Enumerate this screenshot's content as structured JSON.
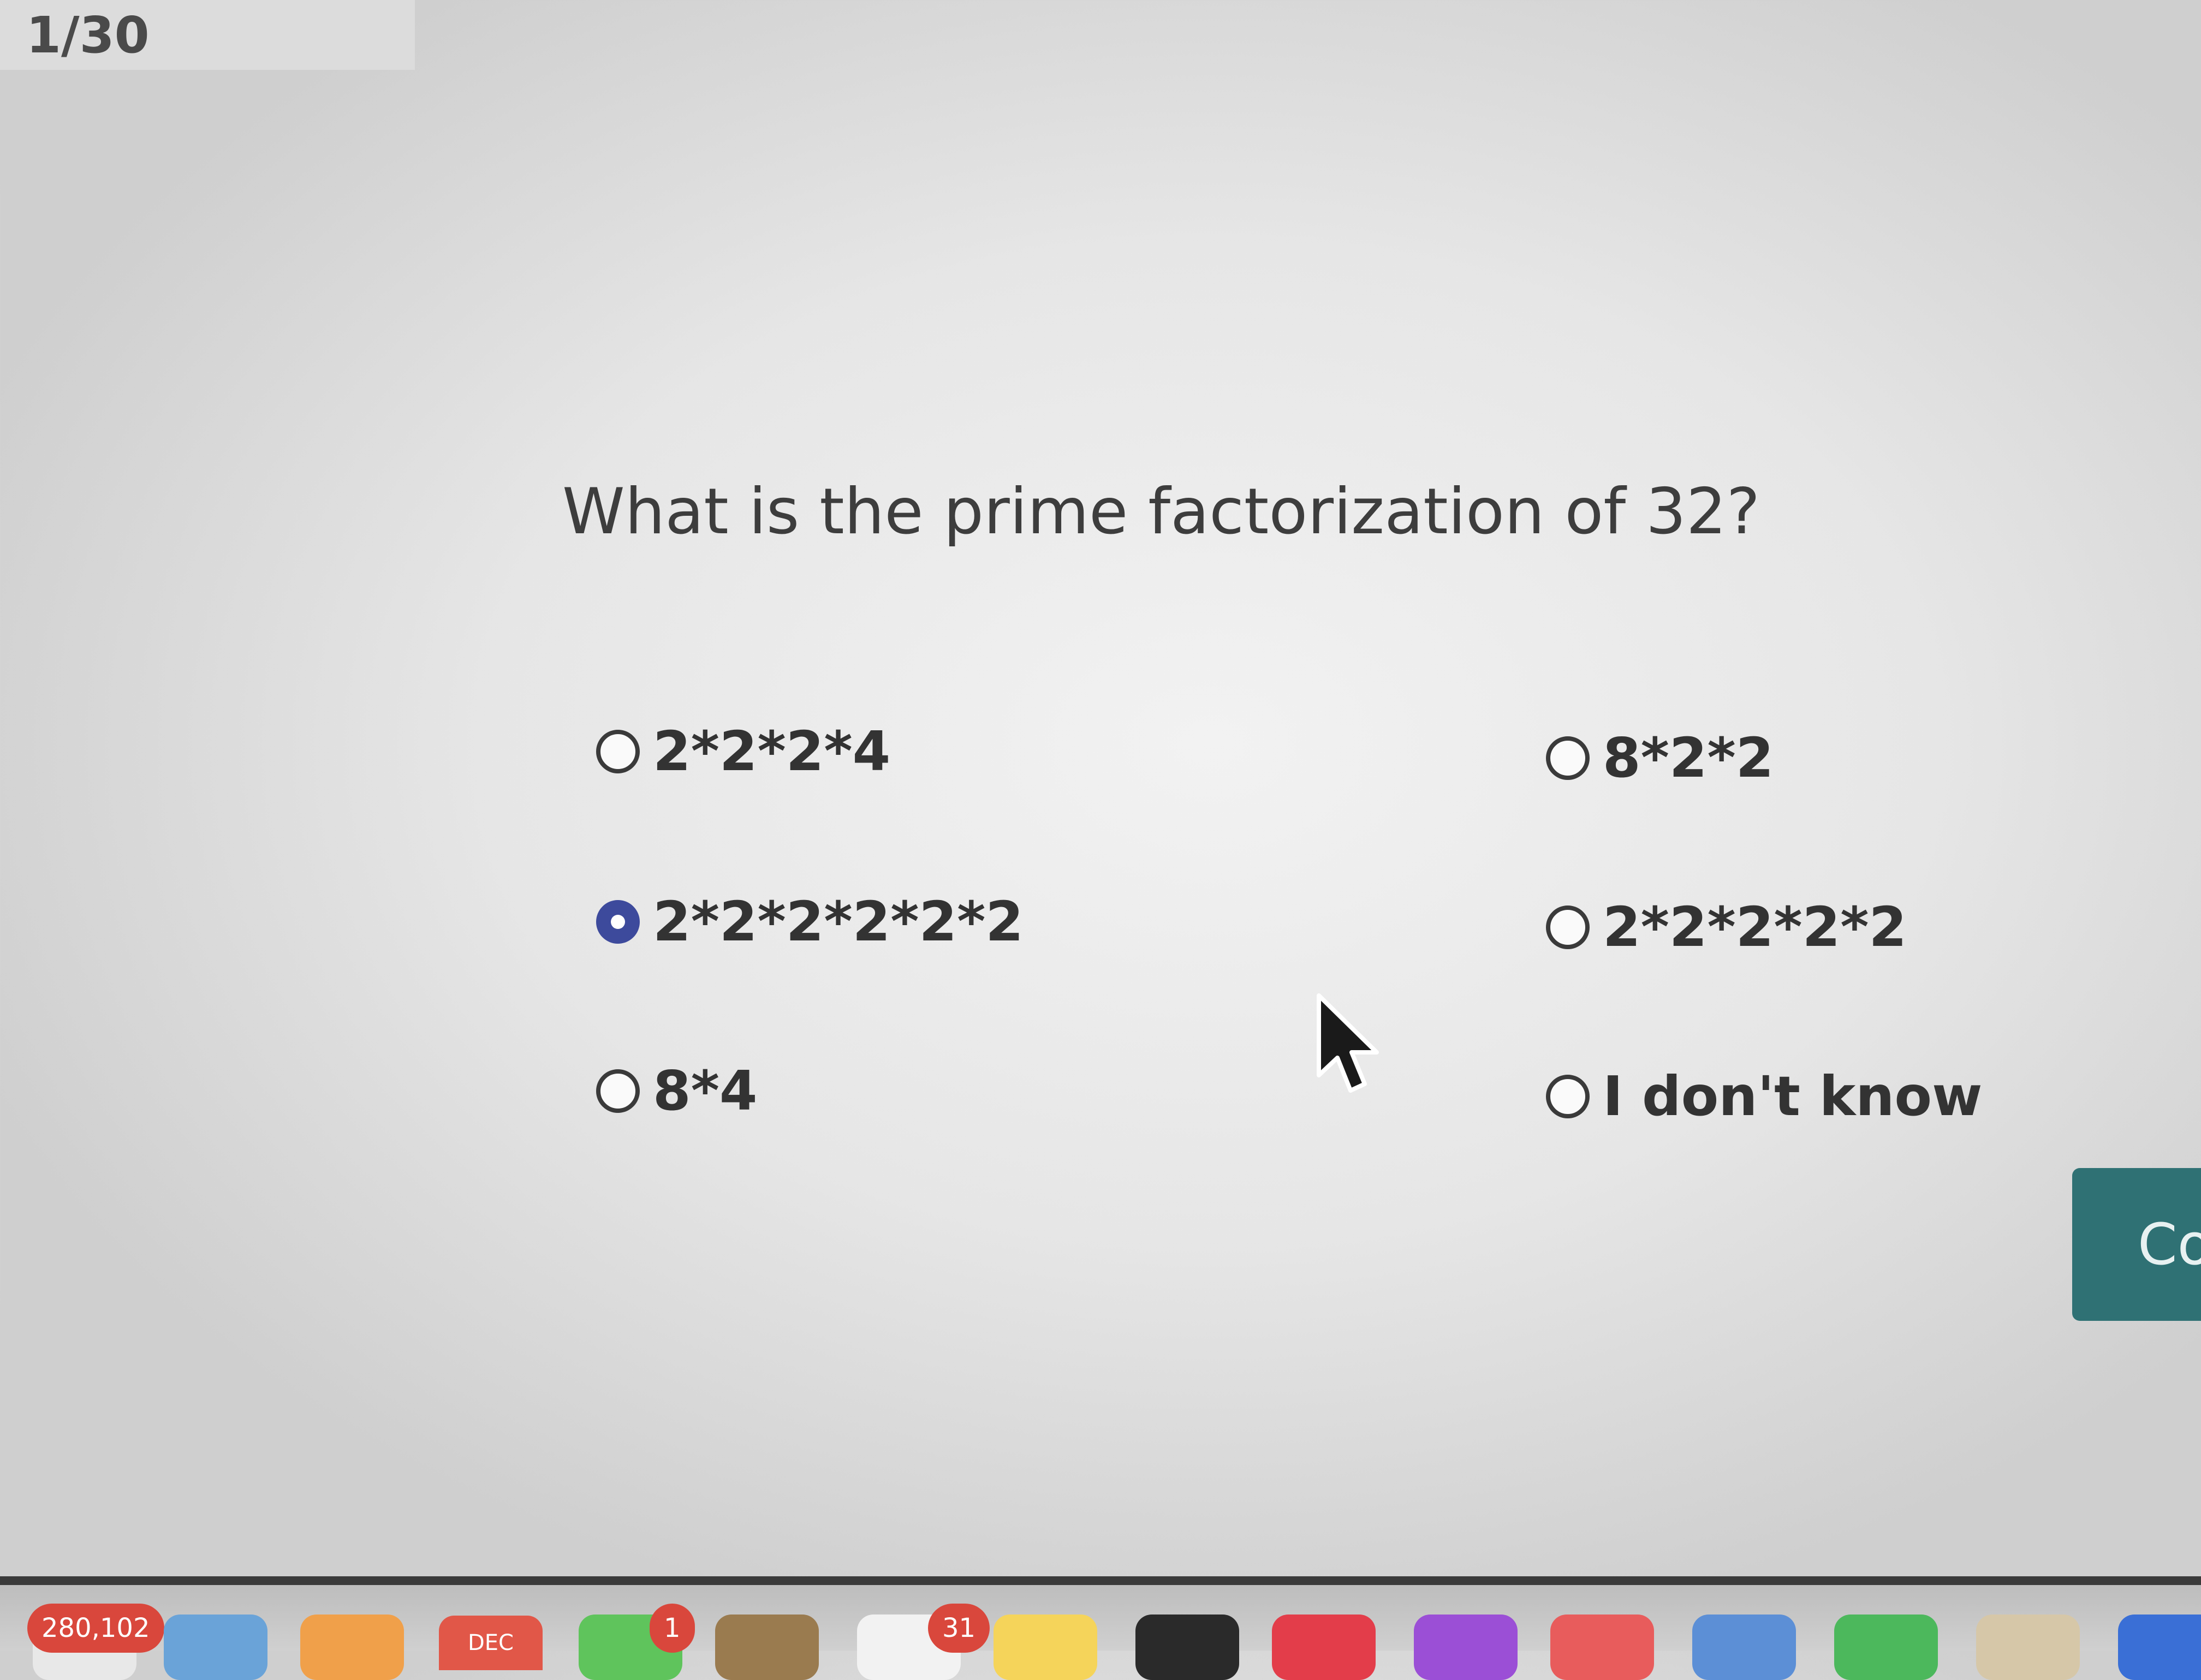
{
  "progress": {
    "label": "1/30"
  },
  "question": {
    "text": "What is the prime factorization of 32?"
  },
  "options": [
    {
      "label": "2*2*2*4",
      "selected": false
    },
    {
      "label": "2*2*2*2*2*2",
      "selected": true
    },
    {
      "label": "8*4",
      "selected": false
    },
    {
      "label": "8*2*2",
      "selected": false
    },
    {
      "label": "2*2*2*2*2",
      "selected": false
    },
    {
      "label": "I don't know",
      "selected": false
    }
  ],
  "continue_button": {
    "label": "Co"
  },
  "dock": {
    "badge_mail_count": "280,102",
    "calendar_month": "DEC",
    "badge_messages_count": "1",
    "badge_calendar_day": "31"
  },
  "colors": {
    "selected_radio": "#3d4a9c",
    "continue_button": "#2f7174",
    "badge": "#d9473c"
  }
}
